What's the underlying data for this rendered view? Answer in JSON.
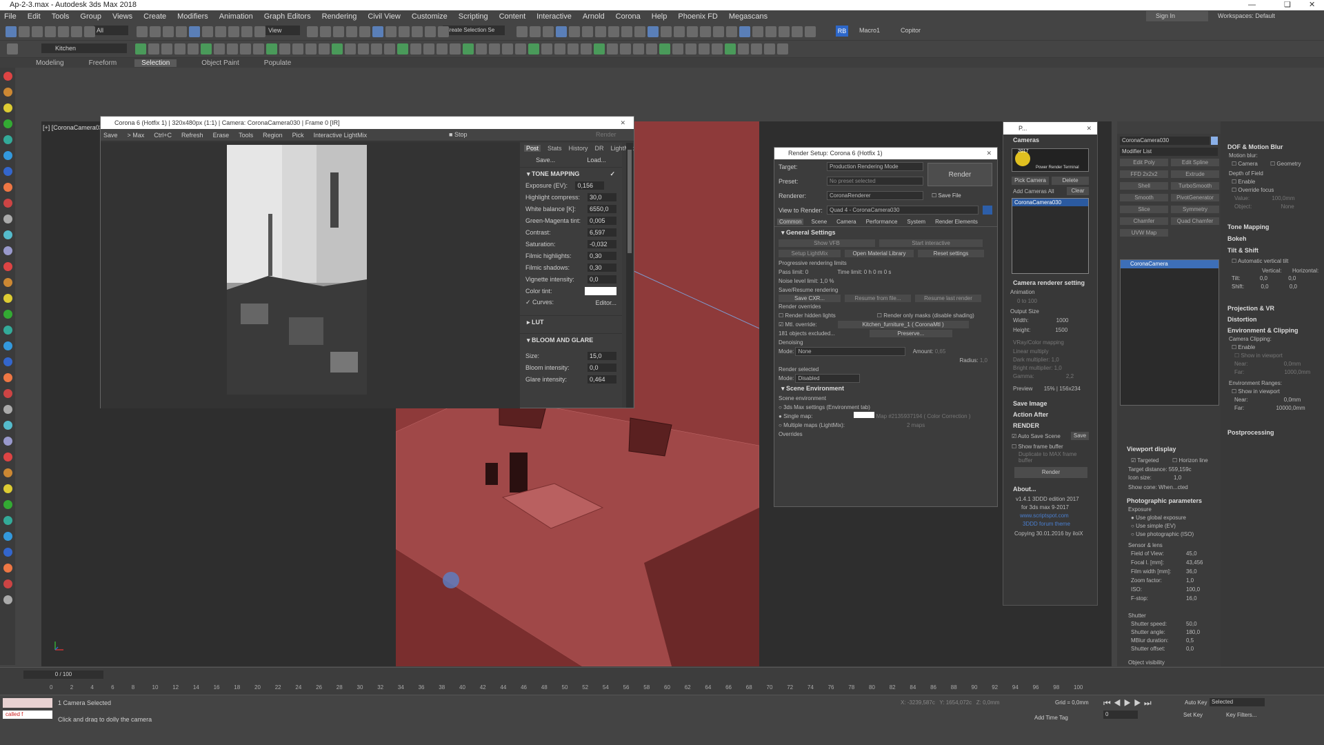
{
  "app": {
    "title": "Ap-2-3.max - Autodesk 3ds Max 2018",
    "sign_in": "Sign In",
    "workspace_label": "Workspaces:",
    "workspace_value": "Default"
  },
  "menus": [
    "File",
    "Edit",
    "Tools",
    "Group",
    "Views",
    "Create",
    "Modifiers",
    "Animation",
    "Graph Editors",
    "Rendering",
    "Civil View",
    "Customize",
    "Scripting",
    "Content",
    "Interactive",
    "Arnold",
    "Corona",
    "Help",
    "Phoenix FD",
    "Megascans"
  ],
  "toolbar": {
    "selection_filter": "All",
    "view": "View",
    "named_selection": "Create Selection Se",
    "layer": "Kitchen",
    "macro": "Macro1",
    "copitor": "Copitor",
    "rb": "RB"
  },
  "ribbon": {
    "tabs": [
      "Modeling",
      "Freeform",
      "Selection",
      "Object Paint",
      "Populate"
    ],
    "active": "Selection"
  },
  "viewport": {
    "label": "[+] [CoronaCamera030]"
  },
  "vfb": {
    "title": "Corona 6 (Hotfix 1) | 320x480px (1:1) | Camera: CoronaCamera030 | Frame 0 [IR]",
    "toolbar": [
      "Save",
      "> Max",
      "Ctrl+C",
      "Refresh",
      "Erase",
      "Tools",
      "Region",
      "Pick",
      "Interactive LightMix"
    ],
    "stop": "Stop",
    "render": "Render",
    "tabs": [
      "Post",
      "Stats",
      "History",
      "DR",
      "LightMix"
    ],
    "save": "Save...",
    "load": "Load...",
    "tone_mapping": "TONE MAPPING",
    "params": [
      {
        "label": "Exposure (EV):",
        "value": "0,156"
      },
      {
        "label": "Highlight compress:",
        "value": "30,0"
      },
      {
        "label": "White balance [K]:",
        "value": "6550,0"
      },
      {
        "label": "Green-Magenta tint:",
        "value": "0,005"
      },
      {
        "label": "Contrast:",
        "value": "6,597"
      },
      {
        "label": "Saturation:",
        "value": "-0,032"
      },
      {
        "label": "Filmic highlights:",
        "value": "0,30"
      },
      {
        "label": "Filmic shadows:",
        "value": "0,30"
      },
      {
        "label": "Vignette intensity:",
        "value": "0,0"
      }
    ],
    "color_tint": "Color tint:",
    "curves": "Curves:",
    "editor": "Editor...",
    "lut": "LUT",
    "bloom": "BLOOM AND GLARE",
    "bloom_params": [
      {
        "label": "Size:",
        "value": "15,0"
      },
      {
        "label": "Bloom intensity:",
        "value": "0,0"
      },
      {
        "label": "Glare intensity:",
        "value": "0,464"
      }
    ]
  },
  "render_setup": {
    "title": "Render Setup: Corona 6 (Hotfix 1)",
    "target_label": "Target:",
    "target": "Production Rendering Mode",
    "preset_label": "Preset:",
    "preset": "No preset selected",
    "renderer_label": "Renderer:",
    "renderer": "CoronaRenderer",
    "save_file": "Save File",
    "view_label": "View to Render:",
    "view": "Quad 4 - CoronaCamera030",
    "render": "Render",
    "tabs": [
      "Common",
      "Scene",
      "Camera",
      "Performance",
      "System",
      "Render Elements"
    ],
    "general": "General Settings",
    "show_vfb": "Show VFB",
    "start_interactive": "Start interactive",
    "setup_lightmix": "Setup LightMix",
    "open_material_library": "Open Material Library",
    "reset_settings": "Reset settings",
    "prog_limits": "Progressive rendering limits",
    "pass_limit": "Pass limit:",
    "pass_value": "0",
    "time_limit": "Time limit:",
    "time_h": "0",
    "h": "h",
    "time_m": "0",
    "m": "m",
    "time_s": "0",
    "s": "s",
    "noise_label": "Noise level limit:",
    "noise_value": "1,0",
    "pct": "%",
    "save_resume": "Save/Resume rendering",
    "save_cxr": "Save CXR...",
    "resume_file": "Resume from file...",
    "resume_last": "Resume last render",
    "overrides": "Render overrides",
    "hidden": "Render hidden lights",
    "masks": "Render only masks (disable shading)",
    "mtl_override": "Mtl. override:",
    "mtl_value": "Kitchen_furniture_1 ( CoronaMtl )",
    "excluded": "181 objects excluded...",
    "preserve": "Preserve...",
    "denoising": "Denoising",
    "mode_label": "Mode:",
    "mode": "None",
    "amount_label": "Amount:",
    "amount": "0,65",
    "radius_label": "Radius:",
    "radius": "1,0",
    "render_selected": "Render selected",
    "rs_mode": "Disabled",
    "scene_env": "Scene Environment",
    "scene_env_sub": "Scene environment",
    "env_tab": "3ds Max settings (Environment tab)",
    "single_map": "Single map:",
    "map_name": "Map #2135937194 ( Color Correction )",
    "multiple_maps": "Multiple maps (LightMix):",
    "maps_count": "2 maps",
    "overrides_label": "Overrides"
  },
  "camera_panel": {
    "header": "P...",
    "cameras": "Cameras",
    "pick": "Pick Camera",
    "delete": "Delete",
    "add": "Add Cameras",
    "all": "All",
    "clear": "Clear",
    "selected": "CoronaCamera030",
    "year": "2017",
    "brand": "Power Render Terminal",
    "crs": "Camera renderer setting",
    "animation": "Animation",
    "anim_from": "0",
    "anim_to_label": "to",
    "anim_to": "100",
    "output": "Output Size",
    "width_label": "Width:",
    "width": "1000",
    "height_label": "Height:",
    "height": "1500",
    "color_map": "VRay/Color mapping",
    "cm_mode": "Linear multiply",
    "dark": "Dark multiplier:",
    "dark_v": "1,0",
    "bright": "Bright multiplier:",
    "bright_v": "1,0",
    "gamma": "Gamma:",
    "gamma_v": "2,2",
    "preview": "Preview",
    "preview_v": "15% | 156x234",
    "save_image": "Save Image",
    "action_after": "Action After",
    "render_sec": "RENDER",
    "auto_save": "Auto Save Scene",
    "save": "Save",
    "show_fb": "Show frame buffer",
    "dup": "Duplicate to MAX frame buffer",
    "render_btn": "Render",
    "about": "About...",
    "about1": "v1.4.1 3DDD edition 2017",
    "about2": "for 3ds max 9-2017",
    "about3": "www.scriptspot.com",
    "about4": "3DDD forum theme",
    "about5": "Copying 30.01.2016 by iloiX"
  },
  "command_panel": {
    "name": "CoronaCamera030",
    "modifier_list": "Modifier List",
    "mods": [
      "Edit Poly",
      "Edit Spline",
      "FFD 2x2x2",
      "Extrude",
      "Shell",
      "TurboSmooth",
      "Smooth",
      "PivotGenerator",
      "Slice",
      "Symmetry",
      "Chamfer",
      "Quad Chamfer",
      "UVW Map"
    ],
    "stack_item": "CoronaCamera",
    "viewport_display": "Viewport display",
    "targeted": "Targeted",
    "horizon": "Horizon line",
    "target_dist": "Target distance:",
    "target_dist_v": "559,159c",
    "icon_size": "Icon size:",
    "icon_size_v": "1,0",
    "show_cone": "Show cone:",
    "show_cone_v": "When...cted",
    "photo": "Photographic parameters",
    "exposure": "Exposure",
    "use_global": "Use global exposure",
    "use_simple": "Use simple (EV)",
    "use_photo": "Use photographic (ISO)",
    "sensor": "Sensor & lens",
    "fov": "Field of View:",
    "fov_v": "45,0",
    "focal": "Focal l. [mm]:",
    "focal_v": "43,456",
    "film": "Film width [mm]:",
    "film_v": "36,0",
    "zoom": "Zoom factor:",
    "zoom_v": "1,0",
    "iso": "ISO:",
    "iso_v": "100,0",
    "fstop": "F-stop:",
    "fstop_v": "16,0",
    "shutter": "Shutter",
    "sspeed": "Shutter speed:",
    "sspeed_v": "50,0",
    "sangle": "Shutter angle:",
    "sangle_v": "180,0",
    "mblur": "MBlur duration:",
    "mblur_v": "0,5",
    "soffset": "Shutter offset:",
    "soffset_v": "0,0",
    "obj_vis": "Object visibility",
    "dof_mb": "DOF & Motion Blur",
    "motion_blur": "Motion blur:",
    "camera": "Camera",
    "geometry": "Geometry",
    "dof": "Depth of Field",
    "enable": "Enable",
    "override_focus": "Override focus",
    "value": "Value:",
    "value_v": "100,0mm",
    "object": "Object:",
    "none": "None",
    "tone_mapping": "Tone Mapping",
    "bokeh": "Bokeh",
    "tilt_shift": "Tilt & Shift",
    "auto_tilt": "Automatic vertical tilt",
    "vertical": "Vertical:",
    "horizontal": "Horizontal:",
    "tilt": "Tilt:",
    "tilt_v": "0,0",
    "tilt_h": "0,0",
    "shift": "Shift:",
    "shift_v": "0,0",
    "shift_h": "0,0",
    "proj": "Projection & VR",
    "distortion": "Distortion",
    "env_clip": "Environment & Clipping",
    "cam_clip": "Camera Clipping:",
    "clip_enable": "Enable",
    "show_vp": "Show in viewport",
    "near": "Near:",
    "near_v": "0,0mm",
    "far": "Far:",
    "far_v": "1000,0mm",
    "env_ranges": "Environment Ranges:",
    "show_vp2": "Show in viewport",
    "near2_v": "0,0mm",
    "far2_v": "10000,0mm",
    "postprocessing": "Postprocessing"
  },
  "timeline": {
    "frame": "0 / 100",
    "ticks": [
      "0",
      "2",
      "4",
      "6",
      "8",
      "10",
      "12",
      "14",
      "16",
      "18",
      "20",
      "22",
      "24",
      "26",
      "28",
      "30",
      "32",
      "34",
      "36",
      "38",
      "40",
      "42",
      "44",
      "46",
      "48",
      "50",
      "52",
      "54",
      "56",
      "58",
      "60",
      "62",
      "64",
      "66",
      "68",
      "70",
      "72",
      "74",
      "76",
      "78",
      "80",
      "82",
      "84",
      "86",
      "88",
      "90",
      "92",
      "94",
      "96",
      "98",
      "100"
    ]
  },
  "status": {
    "selection": "1 Camera Selected",
    "hint": "Click and drag to dolly the camera",
    "called": "called f",
    "x_label": "X:",
    "x": "-3239,587c",
    "y_label": "Y:",
    "y": "1654,072c",
    "z_label": "Z:",
    "z": "0,0mm",
    "grid": "Grid = 0,0mm",
    "add_time_tag": "Add Time Tag",
    "auto_key": "Auto Key",
    "selected": "Selected",
    "set_key": "Set Key",
    "key_filters": "Key Filters...",
    "frame_field": "0"
  }
}
